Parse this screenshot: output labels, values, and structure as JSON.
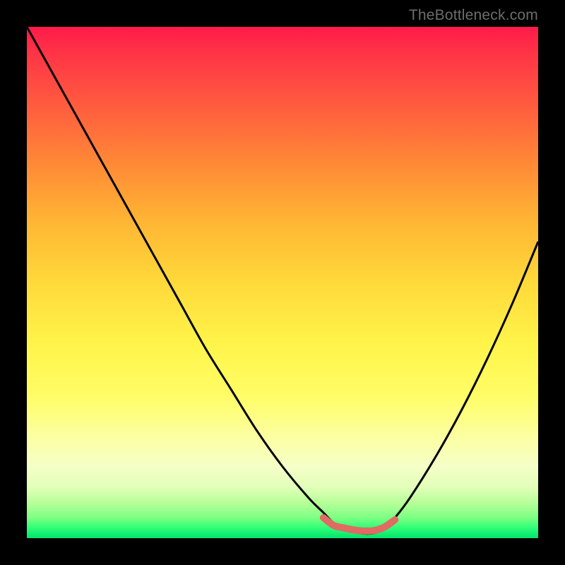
{
  "attribution": "TheBottleneck.com",
  "chart_data": {
    "type": "line",
    "title": "",
    "xlabel": "",
    "ylabel": "",
    "xlim": [
      0,
      100
    ],
    "ylim": [
      0,
      100
    ],
    "series": [
      {
        "name": "bottleneck-curve",
        "x": [
          0,
          5,
          10,
          15,
          20,
          25,
          30,
          35,
          40,
          45,
          50,
          55,
          58,
          60,
          62,
          65,
          68,
          70,
          72,
          75,
          80,
          85,
          90,
          95,
          100
        ],
        "values": [
          100,
          91,
          82,
          73,
          64,
          55,
          46,
          37,
          29,
          21,
          14,
          8,
          5,
          3,
          2,
          1,
          1,
          2,
          4,
          8,
          16,
          25,
          35,
          46,
          58
        ]
      },
      {
        "name": "highlight-segment",
        "x": [
          58,
          60,
          62,
          64,
          66,
          68,
          70,
          72
        ],
        "values": [
          4,
          2.5,
          2,
          1.6,
          1.4,
          1.5,
          2.2,
          3.6
        ]
      }
    ],
    "highlight_color": "#e06b63",
    "curve_color": "#000000"
  }
}
